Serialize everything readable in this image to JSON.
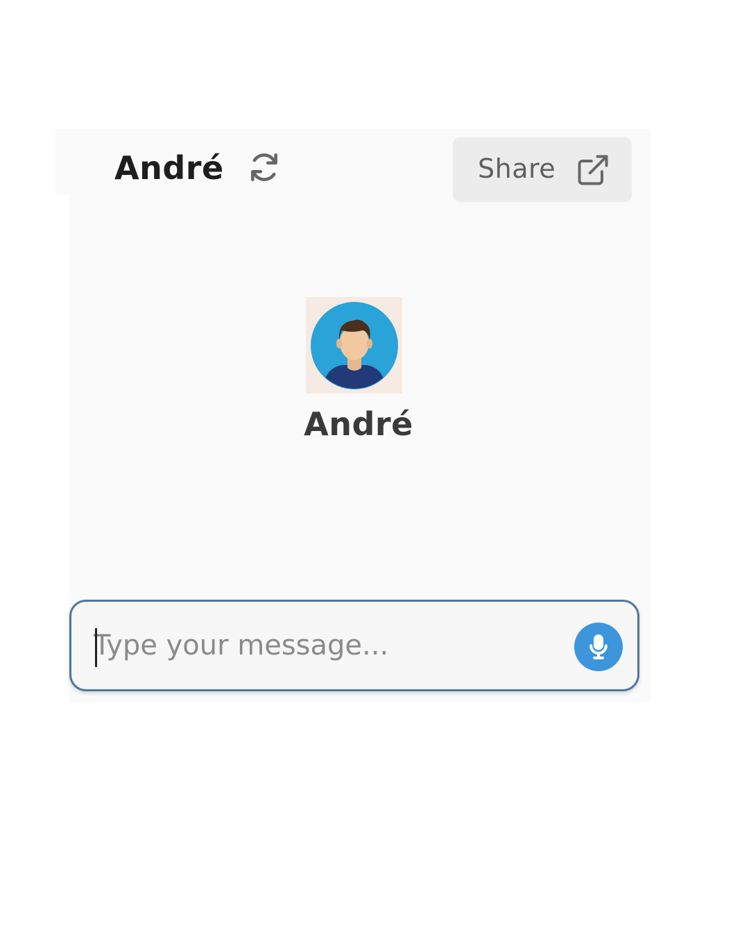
{
  "header": {
    "title": "André",
    "refresh_icon": "refresh-icon",
    "share_label": "Share",
    "share_icon": "external-link-icon"
  },
  "bot": {
    "name": "André",
    "avatar_icon": "avatar-man-icon"
  },
  "composer": {
    "placeholder": "Type your message...",
    "value": "",
    "mic_icon": "microphone-icon"
  },
  "colors": {
    "panel_bg": "#fafafa",
    "share_bg": "#ececec",
    "input_border": "#4f79a0",
    "mic_bg": "#3d95dc",
    "avatar_circle": "#2aa3d8"
  }
}
